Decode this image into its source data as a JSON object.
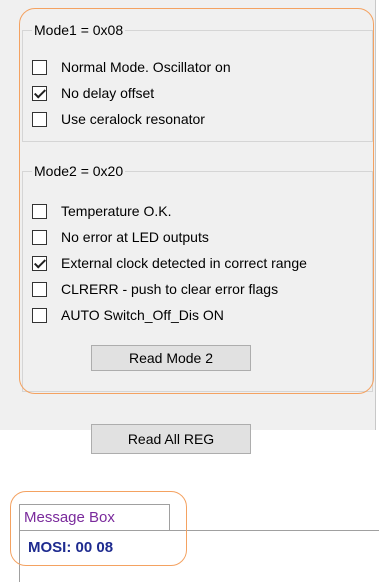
{
  "mode1": {
    "title": "Mode1 = 0x08",
    "options": [
      {
        "label": "Normal Mode. Oscillator on",
        "checked": false
      },
      {
        "label": "No delay offset",
        "checked": true
      },
      {
        "label": "Use ceralock resonator",
        "checked": false
      }
    ]
  },
  "mode2": {
    "title": "Mode2 = 0x20",
    "options": [
      {
        "label": "Temperature O.K.",
        "checked": false
      },
      {
        "label": "No error at LED outputs",
        "checked": false
      },
      {
        "label": "External clock detected in correct range",
        "checked": true
      },
      {
        "label": "CLRERR - push to clear error flags",
        "checked": false
      },
      {
        "label": "AUTO Switch_Off_Dis ON",
        "checked": false
      }
    ],
    "read_button_label": "Read Mode 2"
  },
  "read_all_button_label": "Read All REG",
  "message_box": {
    "tab_label": "Message Box",
    "lines": [
      "MOSI: 00 08"
    ]
  },
  "colors": {
    "highlight": "#f4a261",
    "tab_text": "#7a2a9c",
    "message_text": "#1e2b8f"
  }
}
